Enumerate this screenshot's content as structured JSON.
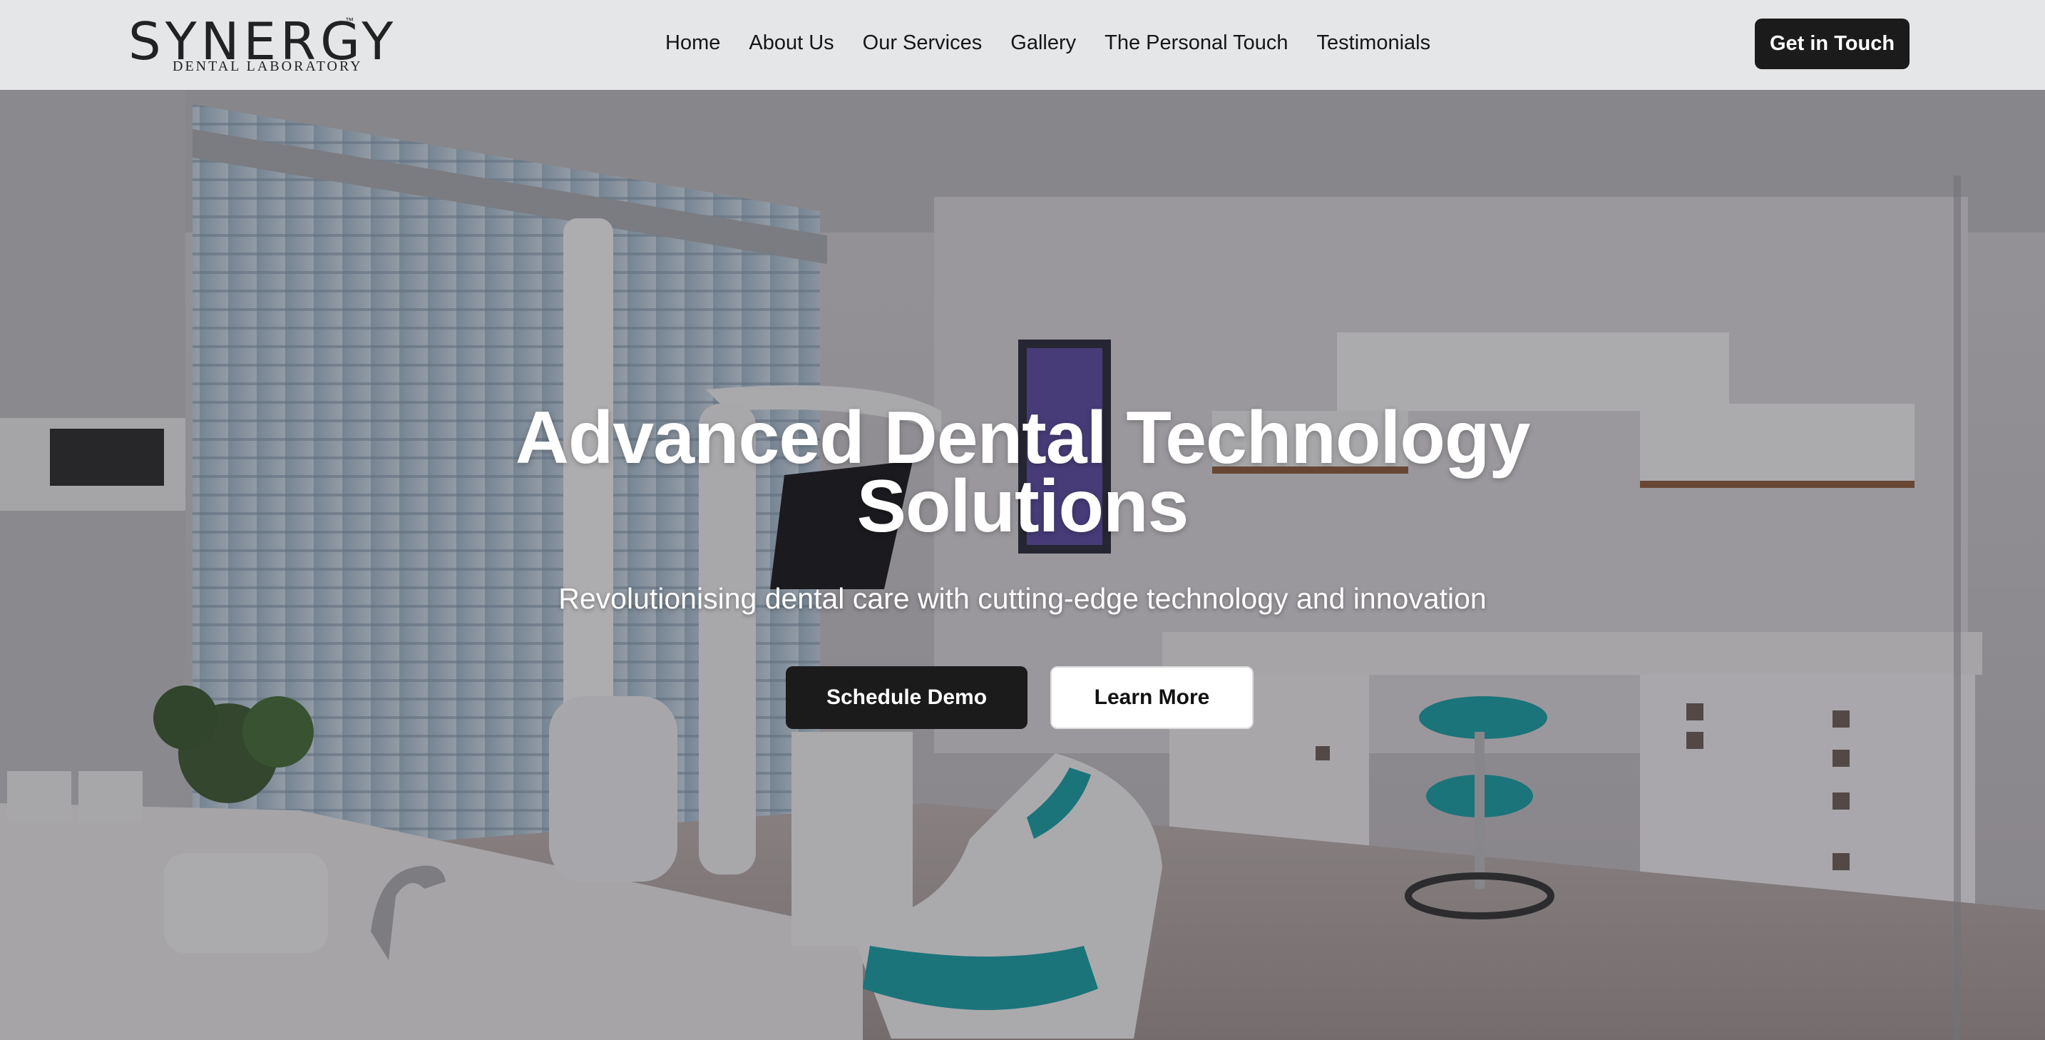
{
  "brand": {
    "name": "SYNERGY",
    "trademark": "™",
    "tagline": "DENTAL LABORATORY"
  },
  "nav": {
    "items": [
      {
        "label": "Home"
      },
      {
        "label": "About Us"
      },
      {
        "label": "Our Services"
      },
      {
        "label": "Gallery"
      },
      {
        "label": "The Personal Touch"
      },
      {
        "label": "Testimonials"
      }
    ],
    "cta_label": "Get in Touch"
  },
  "hero": {
    "title_line1": "Advanced Dental Technology",
    "title_line2": "Solutions",
    "subtitle": "Revolutionising dental care with cutting-edge technology and innovation",
    "primary_button": "Schedule Demo",
    "secondary_button": "Learn More",
    "background_image": "dental-clinic-photo"
  },
  "colors": {
    "header_bg": "#e4e6e8",
    "dark_button": "#1b1b1b",
    "accent_teal": "#1a9ca3"
  }
}
